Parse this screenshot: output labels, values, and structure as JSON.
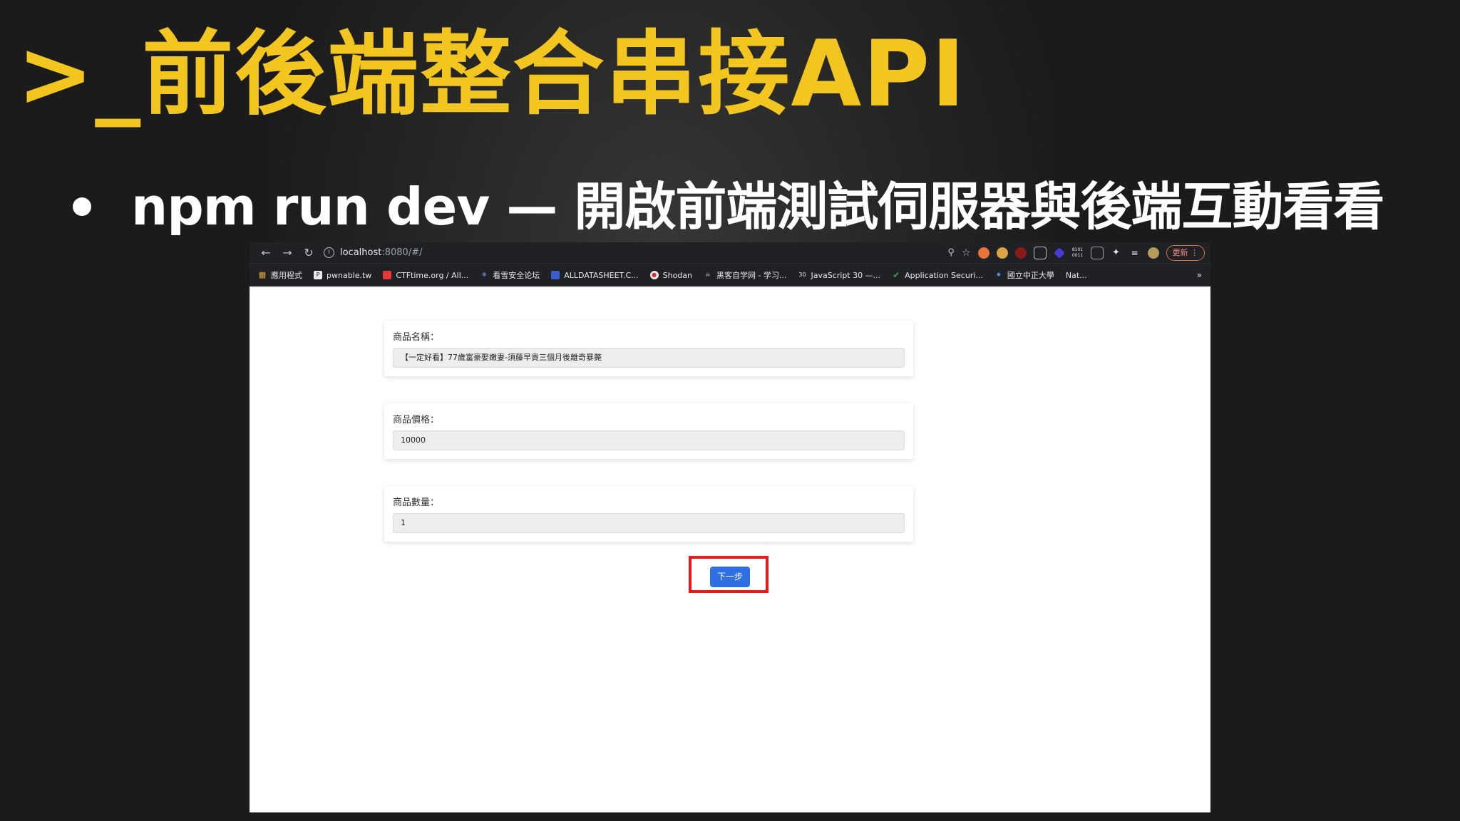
{
  "slide": {
    "title": ">_前後端整合串接API",
    "bullet": "npm run dev — 開啟前端測試伺服器與後端互動看看"
  },
  "browser": {
    "url_host": "localhost",
    "url_rest": ":8080/#/",
    "update_label": "更新",
    "extension_labels": [
      "8101 0011"
    ],
    "bookmarks": [
      {
        "label": "應用程式",
        "icon": "apps-grid-icon"
      },
      {
        "label": "pwnable.tw",
        "icon": "pwnable-icon"
      },
      {
        "label": "CTFtime.org / All...",
        "icon": "ctftime-flag-icon"
      },
      {
        "label": "看雪安全论坛",
        "icon": "kanxue-icon"
      },
      {
        "label": "ALLDATASHEET.C...",
        "icon": "alldatasheet-icon"
      },
      {
        "label": "Shodan",
        "icon": "shodan-icon"
      },
      {
        "label": "黑客自学网 - 学习...",
        "icon": "hacker-icon"
      },
      {
        "label": "JavaScript 30 —...",
        "icon": "js30-icon"
      },
      {
        "label": "Application Securi...",
        "icon": "appsec-check-icon"
      },
      {
        "label": "國立中正大學",
        "icon": "ccu-icon"
      },
      {
        "label": "Nat...",
        "icon": "nat-icon"
      }
    ],
    "bookmarks_more": "»"
  },
  "form": {
    "fields": [
      {
        "label": "商品名稱：",
        "value": "【一定好看】77歲富豪娶嫩妻-須藤早貴三個月後離奇暴斃"
      },
      {
        "label": "商品價格：",
        "value": "10000"
      },
      {
        "label": "商品數量：",
        "value": "1"
      }
    ],
    "next_button": "下一步",
    "highlight_color": "#e31b1b",
    "button_color": "#2f6fe4"
  },
  "colors": {
    "title": "#f2c51f",
    "background": "#1b1b1b"
  }
}
